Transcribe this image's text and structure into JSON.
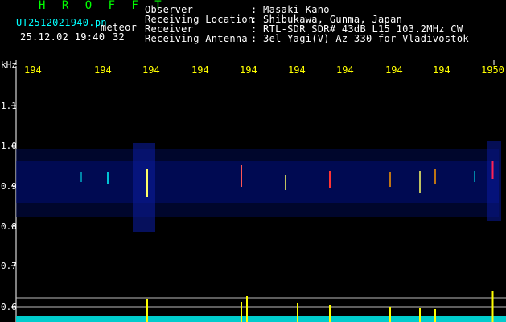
{
  "app": {
    "brand": "H R O F F T",
    "filename": "UT2512021940.pn",
    "meteor_label": "meteor",
    "date_time": "25.12.02 19:40",
    "count": "32"
  },
  "info": [
    {
      "label": "Observer",
      "value": ": Masaki Kano"
    },
    {
      "label": "Receiving Location",
      "value": ": Shibukawa, Gunma, Japan"
    },
    {
      "label": "Receiver",
      "value": ": RTL-SDR SDR# 43dB L15 103.2MHz CW"
    },
    {
      "label": "Receiving Antenna",
      "value": ": 3el Yagi(V) Az 330 for Vladivostok"
    }
  ],
  "axis": {
    "y_unit": "kHz",
    "y_ticks": [
      "1.1",
      "1.0",
      "0.9",
      "0.8",
      "0.7",
      "0.6"
    ],
    "x_ticks": [
      "194",
      "194",
      "194",
      "194",
      "194",
      "194",
      "194",
      "194",
      "194",
      "1950"
    ]
  },
  "colors": {
    "background": "#000000",
    "brand": "#00ff00",
    "filename": "#00ffff",
    "ticks": "#ffff00",
    "bars": "#ffff00",
    "baseline": "#00cccc"
  }
}
